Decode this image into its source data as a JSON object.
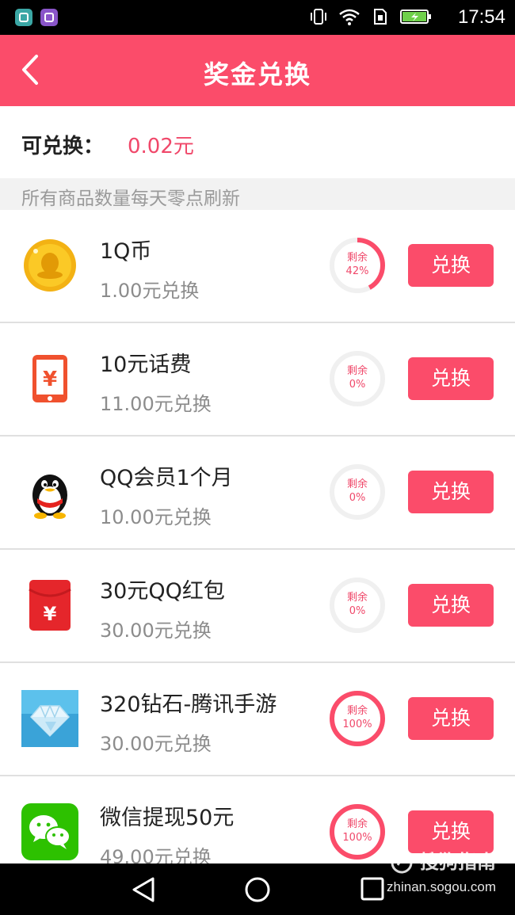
{
  "status_bar": {
    "time": "17:54"
  },
  "header": {
    "title": "奖金兑换"
  },
  "balance": {
    "label": "可兑换：",
    "value": "0.02元"
  },
  "notice": "所有商品数量每天零点刷新",
  "items": [
    {
      "name": "1Q币",
      "price": "1.00元兑换",
      "remaining_label": "剩余",
      "remaining_text": "42%",
      "remaining_fraction": 0.42,
      "button": "兑换",
      "icon": "q-coin-icon"
    },
    {
      "name": "10元话费",
      "price": "11.00元兑换",
      "remaining_label": "剩余",
      "remaining_text": "0%",
      "remaining_fraction": 0,
      "button": "兑换",
      "icon": "phone-credit-icon"
    },
    {
      "name": "QQ会员1个月",
      "price": "10.00元兑换",
      "remaining_label": "剩余",
      "remaining_text": "0%",
      "remaining_fraction": 0,
      "button": "兑换",
      "icon": "qq-penguin-icon"
    },
    {
      "name": "30元QQ红包",
      "price": "30.00元兑换",
      "remaining_label": "剩余",
      "remaining_text": "0%",
      "remaining_fraction": 0,
      "button": "兑换",
      "icon": "red-envelope-icon"
    },
    {
      "name": "320钻石-腾讯手游",
      "price": "30.00元兑换",
      "remaining_label": "剩余",
      "remaining_text": "100%",
      "remaining_fraction": 1,
      "button": "兑换",
      "icon": "diamond-icon"
    },
    {
      "name": "微信提现50元",
      "price": "49.00元兑换",
      "remaining_label": "剩余",
      "remaining_text": "100%",
      "remaining_fraction": 1,
      "button": "兑换",
      "icon": "wechat-icon"
    }
  ],
  "watermark": {
    "text": "搜狗指南",
    "url": "zhinan.sogou.com"
  },
  "colors": {
    "accent": "#fb4c6a",
    "ring_track": "#f0f0f0"
  }
}
